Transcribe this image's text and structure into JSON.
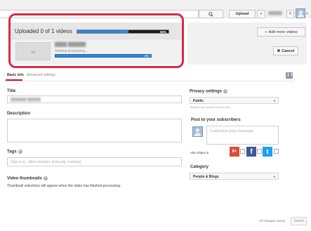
{
  "topbar": {
    "upload_label": "Upload",
    "upload_caret": "▾",
    "notif_count": "0",
    "avatar_caret": "▾"
  },
  "upload": {
    "status_text": "Uploaded 0 of 1 videos",
    "overall_progress_label": "56%",
    "overall_progress": 0.56,
    "file_status": "Starting processing...",
    "file_progress_label": "0%",
    "add_more_label": "Add more videos",
    "add_more_glyph": "+",
    "cancel_label": "Cancel",
    "cancel_glyph": "✖"
  },
  "tabs": [
    {
      "label": "Basic info"
    },
    {
      "label": "Advanced settings"
    }
  ],
  "form": {
    "title_label": "Title",
    "description_label": "Description",
    "tags_label": "Tags",
    "tags_placeholder": "Tags (e.g., albert einstein, flying pig, mashup)",
    "thumbnails_label": "Video thumbnails",
    "thumbnails_note": "Thumbnail selections will appear when the video has finished processing."
  },
  "right": {
    "privacy_label": "Privacy settings",
    "privacy_value": "Public",
    "privacy_note": "Anyone can search for and view",
    "post_label": "Post to your subscribers",
    "custom_msg_placeholder": "Customize your message",
    "also_share_label": "Also share to",
    "gplus_glyph": "8+",
    "fb_glyph": "f",
    "tw_glyph": "t",
    "category_label": "Category",
    "category_value": "People & Blogs",
    "select_caret": "▾"
  },
  "footer": {
    "saved_note": "All changes saved.",
    "save_label": "Saved"
  },
  "colors": {
    "highlight": "#d52b4a",
    "progress_blue": "#2f86d8",
    "tab_accent": "#cc181e"
  }
}
